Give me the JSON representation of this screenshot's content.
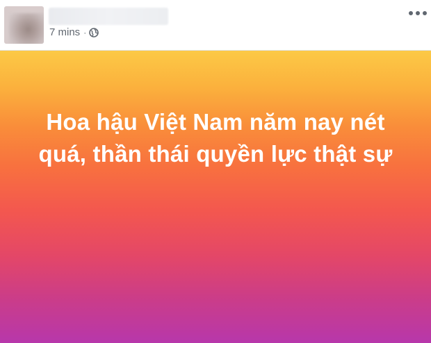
{
  "post": {
    "meta": {
      "time": "7 mins",
      "separator": "·",
      "audience_icon": "globe-icon"
    },
    "more_icon": "more-options-icon",
    "status_text": "Hoa hậu Việt Nam năm nay nét quá, thần thái quyền lực thật sự",
    "background_gradient": [
      "#fcc946",
      "#f98d3a",
      "#f3574f",
      "#cc3d87",
      "#b737ab"
    ],
    "text_color": "#ffffff"
  }
}
